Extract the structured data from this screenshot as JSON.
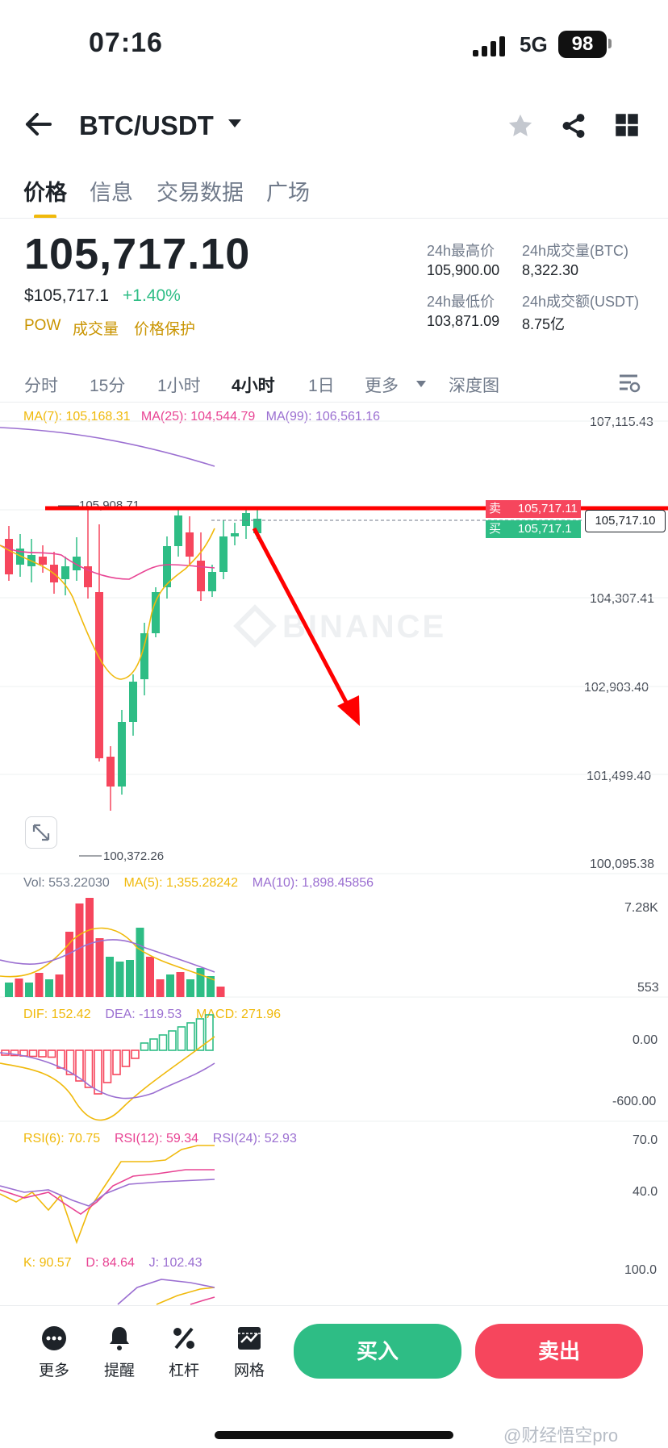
{
  "status_bar": {
    "time": "07:16",
    "network": "5G",
    "battery": "98"
  },
  "header": {
    "title": "BTC/USDT",
    "icons": [
      "back-arrow-icon",
      "star-icon",
      "share-icon",
      "grid-icon"
    ]
  },
  "tabs": [
    "价格",
    "信息",
    "交易数据",
    "广场"
  ],
  "active_tab": 0,
  "ticker": {
    "last_price": "105,717.10",
    "usd_price": "$105,717.1",
    "change": "+1.40%",
    "tags": [
      "POW",
      "成交量",
      "价格保护"
    ],
    "stats": [
      {
        "label": "24h最高价",
        "value": "105,900.00"
      },
      {
        "label": "24h成交量(BTC)",
        "value": "8,322.30"
      },
      {
        "label": "24h最低价",
        "value": "103,871.09"
      },
      {
        "label": "24h成交额(USDT)",
        "value": "8.75亿"
      }
    ]
  },
  "intervals": [
    "分时",
    "15分",
    "1小时",
    "4小时",
    "1日",
    "更多",
    "深度图"
  ],
  "active_interval": "4小时",
  "main_chart": {
    "legend": [
      {
        "text": "MA(7): 105,168.31",
        "color": "#f0b90b"
      },
      {
        "text": "MA(25): 104,544.79",
        "color": "#e84393"
      },
      {
        "text": "MA(99): 106,561.16",
        "color": "#9b6fd1"
      }
    ],
    "y_labels": [
      "107,115.43",
      "104,307.41",
      "102,903.40",
      "101,499.40",
      "100,095.38"
    ],
    "high_marker": "105,908.71",
    "low_marker": "100,372.26",
    "sell_label": "卖",
    "sell_price": "105,717.11",
    "buy_label": "买",
    "buy_price": "105,717.1",
    "current_price_tag": "105,717.10",
    "watermark": "BINANCE"
  },
  "volume_panel": {
    "legend": [
      {
        "text": "Vol: 553.22030",
        "color": "#707a8a"
      },
      {
        "text": "MA(5): 1,355.28242",
        "color": "#f0b90b"
      },
      {
        "text": "MA(10): 1,898.45856",
        "color": "#9b6fd1"
      }
    ],
    "y_labels": [
      "7.28K",
      "553"
    ]
  },
  "macd_panel": {
    "legend": [
      {
        "text": "DIF: 152.42",
        "color": "#f0b90b"
      },
      {
        "text": "DEA: -119.53",
        "color": "#9b6fd1"
      },
      {
        "text": "MACD: 271.96",
        "color": "#f0b90b"
      }
    ],
    "y_labels": [
      "0.00",
      "-600.00"
    ]
  },
  "rsi_panel": {
    "legend": [
      {
        "text": "RSI(6): 70.75",
        "color": "#f0b90b"
      },
      {
        "text": "RSI(12): 59.34",
        "color": "#e84393"
      },
      {
        "text": "RSI(24): 52.93",
        "color": "#9b6fd1"
      }
    ],
    "y_labels": [
      "70.0",
      "40.0"
    ]
  },
  "kdj_panel": {
    "legend": [
      {
        "text": "K: 90.57",
        "color": "#f0b90b"
      },
      {
        "text": "D: 84.64",
        "color": "#e84393"
      },
      {
        "text": "J: 102.43",
        "color": "#9b6fd1"
      }
    ],
    "y_labels": [
      "100.0"
    ]
  },
  "bottom_bar": {
    "tools": [
      "更多",
      "提醒",
      "杠杆",
      "网格"
    ],
    "buy_button": "买入",
    "sell_button": "卖出"
  },
  "watermark_credit": "@财经悟空pro",
  "colors": {
    "up": "#2ebd85",
    "down": "#f6465d",
    "accent": "#f0b90b",
    "annotation": "#ff0000"
  }
}
